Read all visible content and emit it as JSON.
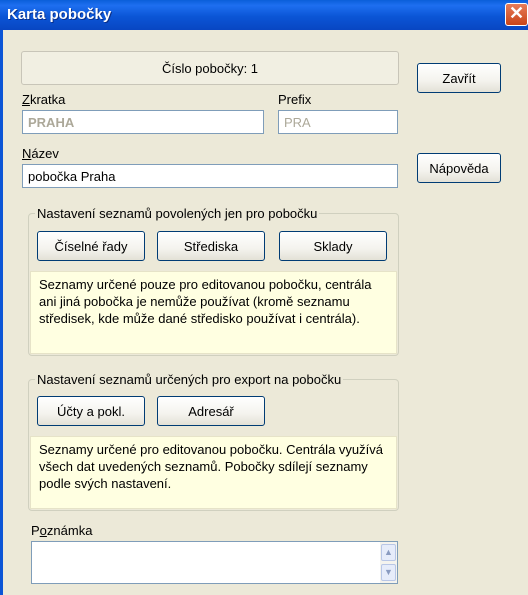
{
  "window": {
    "title": "Karta pobočky",
    "close_glyph": "✕"
  },
  "header": {
    "branch_number_label": "Číslo pobočky: 1"
  },
  "fields": {
    "abbrev_label_u": "Z",
    "abbrev_label_rest": "kratka",
    "abbrev_value": "PRAHA",
    "prefix_label": "Prefix",
    "prefix_value": "PRA",
    "name_label_u": "N",
    "name_label_rest": "ázev",
    "name_value": "pobočka Praha"
  },
  "group1": {
    "title": "Nastavení seznamů povolených jen pro pobočku",
    "buttons": [
      "Číselné řady",
      "Střediska",
      "Sklady"
    ],
    "info": "Seznamy určené pouze pro editovanou pobočku, centrála ani jiná pobočka je nemůže používat (kromě seznamu středisek, kde může dané středisko používat i centrála)."
  },
  "group2": {
    "title": "Nastavení seznamů určených pro export na pobočku",
    "buttons": [
      "Účty a pokl.",
      "Adresář"
    ],
    "info": "Seznamy určené pro editovanou pobočku. Centrála využívá všech dat uvedených seznamů. Pobočky sdílejí seznamy podle svých nastavení."
  },
  "note": {
    "label_first": "P",
    "label_u": "o",
    "label_rest": "známka",
    "value": ""
  },
  "side_buttons": {
    "close": "Zavřít",
    "help": "Nápověda"
  },
  "scroll": {
    "up": "▲",
    "down": "▼"
  }
}
